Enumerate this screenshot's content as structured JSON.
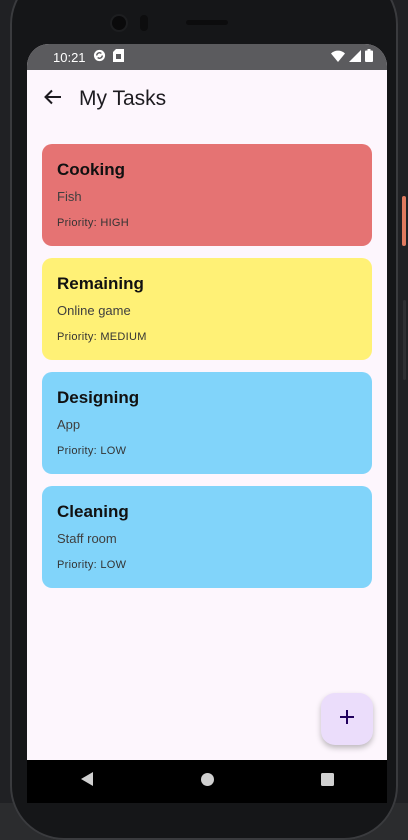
{
  "status_bar": {
    "time": "10:21",
    "icons": [
      "sync-icon",
      "sim-card-icon",
      "wifi-icon",
      "signal-icon",
      "battery-icon"
    ]
  },
  "app_bar": {
    "title": "My Tasks",
    "back_icon": "arrow-back-icon"
  },
  "tasks": [
    {
      "title": "Cooking",
      "description": "Fish",
      "priority": "Priority: HIGH",
      "color": "#e57373"
    },
    {
      "title": "Remaining",
      "description": "Online game",
      "priority": "Priority: MEDIUM",
      "color": "#fff176"
    },
    {
      "title": "Designing",
      "description": "App",
      "priority": "Priority: LOW",
      "color": "#81d4fa"
    },
    {
      "title": "Cleaning",
      "description": "Staff room",
      "priority": "Priority: LOW",
      "color": "#81d4fa"
    }
  ],
  "fab": {
    "icon": "plus-icon"
  },
  "colors": {
    "background": "#fdf6fd",
    "fab": "#ebddfb",
    "high": "#e57373",
    "medium": "#fff176",
    "low": "#81d4fa"
  },
  "nav_bar": {
    "buttons": [
      "back-triangle-icon",
      "home-circle-icon",
      "recents-square-icon"
    ]
  }
}
